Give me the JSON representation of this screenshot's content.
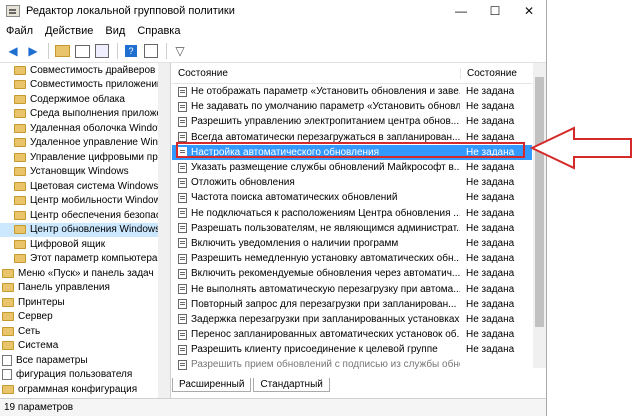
{
  "window": {
    "title": "Редактор локальной групповой политики"
  },
  "menu": [
    "Файл",
    "Действие",
    "Вид",
    "Справка"
  ],
  "tree": [
    {
      "label": "Совместимость драйверов и с",
      "type": "folder"
    },
    {
      "label": "Совместимость приложений",
      "type": "folder"
    },
    {
      "label": "Содержимое облака",
      "type": "folder"
    },
    {
      "label": "Среда выполнения приложен",
      "type": "folder"
    },
    {
      "label": "Удаленная оболочка Windows",
      "type": "folder"
    },
    {
      "label": "Удаленное управление Windo",
      "type": "folder"
    },
    {
      "label": "Управление цифровыми прав",
      "type": "folder"
    },
    {
      "label": "Установщик Windows",
      "type": "folder"
    },
    {
      "label": "Цветовая система Windows C",
      "type": "folder"
    },
    {
      "label": "Центр мобильности Windows",
      "type": "folder"
    },
    {
      "label": "Центр обеспечения безопас",
      "type": "folder"
    },
    {
      "label": "Центр обновления Windows",
      "type": "folder",
      "selected": true
    },
    {
      "label": "Цифровой ящик",
      "type": "folder"
    },
    {
      "label": "Этот параметр компьютера поз",
      "type": "folder"
    },
    {
      "label": "Меню «Пуск» и панель задач",
      "type": "folder"
    },
    {
      "label": "Панель управления",
      "type": "folder"
    },
    {
      "label": "Принтеры",
      "type": "folder"
    },
    {
      "label": "Сервер",
      "type": "folder"
    },
    {
      "label": "Сеть",
      "type": "folder"
    },
    {
      "label": "Система",
      "type": "folder"
    },
    {
      "label": "Все параметры",
      "type": "doc"
    },
    {
      "label": "фигурация пользователя",
      "type": "doc"
    },
    {
      "label": "ограммная конфигурация",
      "type": "folder"
    }
  ],
  "list": {
    "header": {
      "name": "Состояние",
      "state": "Состояние"
    },
    "rows": [
      {
        "name": "Не отображать параметр «Установить обновления и заве...",
        "state": "Не задана"
      },
      {
        "name": "Не задавать по умолчанию параметр «Установить обновл...",
        "state": "Не задана"
      },
      {
        "name": "Разрешить управлению электропитанием центра обнов...",
        "state": "Не задана"
      },
      {
        "name": "Всегда автоматически перезагружаться в запланирован...",
        "state": "Не задана"
      },
      {
        "name": "Настройка автоматического обновления",
        "state": "Не задана",
        "highlight": true
      },
      {
        "name": "Указать размещение службы обновлений Майкрософт в...",
        "state": "Не задана"
      },
      {
        "name": "Отложить обновления",
        "state": "Не задана"
      },
      {
        "name": "Частота поиска автоматических обновлений",
        "state": "Не задана"
      },
      {
        "name": "Не подключаться к расположениям Центра обновления ...",
        "state": "Не задана"
      },
      {
        "name": "Разрешать пользователям, не являющимся администрат...",
        "state": "Не задана"
      },
      {
        "name": "Включить уведомления о наличии программ",
        "state": "Не задана"
      },
      {
        "name": "Разрешить немедленную установку автоматических обн...",
        "state": "Не задана"
      },
      {
        "name": "Включить рекомендуемые обновления через автоматич...",
        "state": "Не задана"
      },
      {
        "name": "Не выполнять автоматическую перезагрузку при автома...",
        "state": "Не задана"
      },
      {
        "name": "Повторный запрос для перезагрузки при запланирован...",
        "state": "Не задана"
      },
      {
        "name": "Задержка перезагрузки при запланированных установках",
        "state": "Не задана"
      },
      {
        "name": "Перенос запланированных автоматических установок об...",
        "state": "Не задана"
      },
      {
        "name": "Разрешить клиенту присоединение к целевой группе",
        "state": "Не задана"
      },
      {
        "name": "Разрешить прием обновлений с подписью из службы обновления Майкрософт в",
        "state": "",
        "faded": true
      }
    ]
  },
  "tabs": [
    "Расширенный",
    "Стандартный"
  ],
  "status": "19 параметров",
  "colors": {
    "selection": "#3399ff",
    "tree_selected": "#cce8ff",
    "annotation_red": "#d62a2a"
  }
}
